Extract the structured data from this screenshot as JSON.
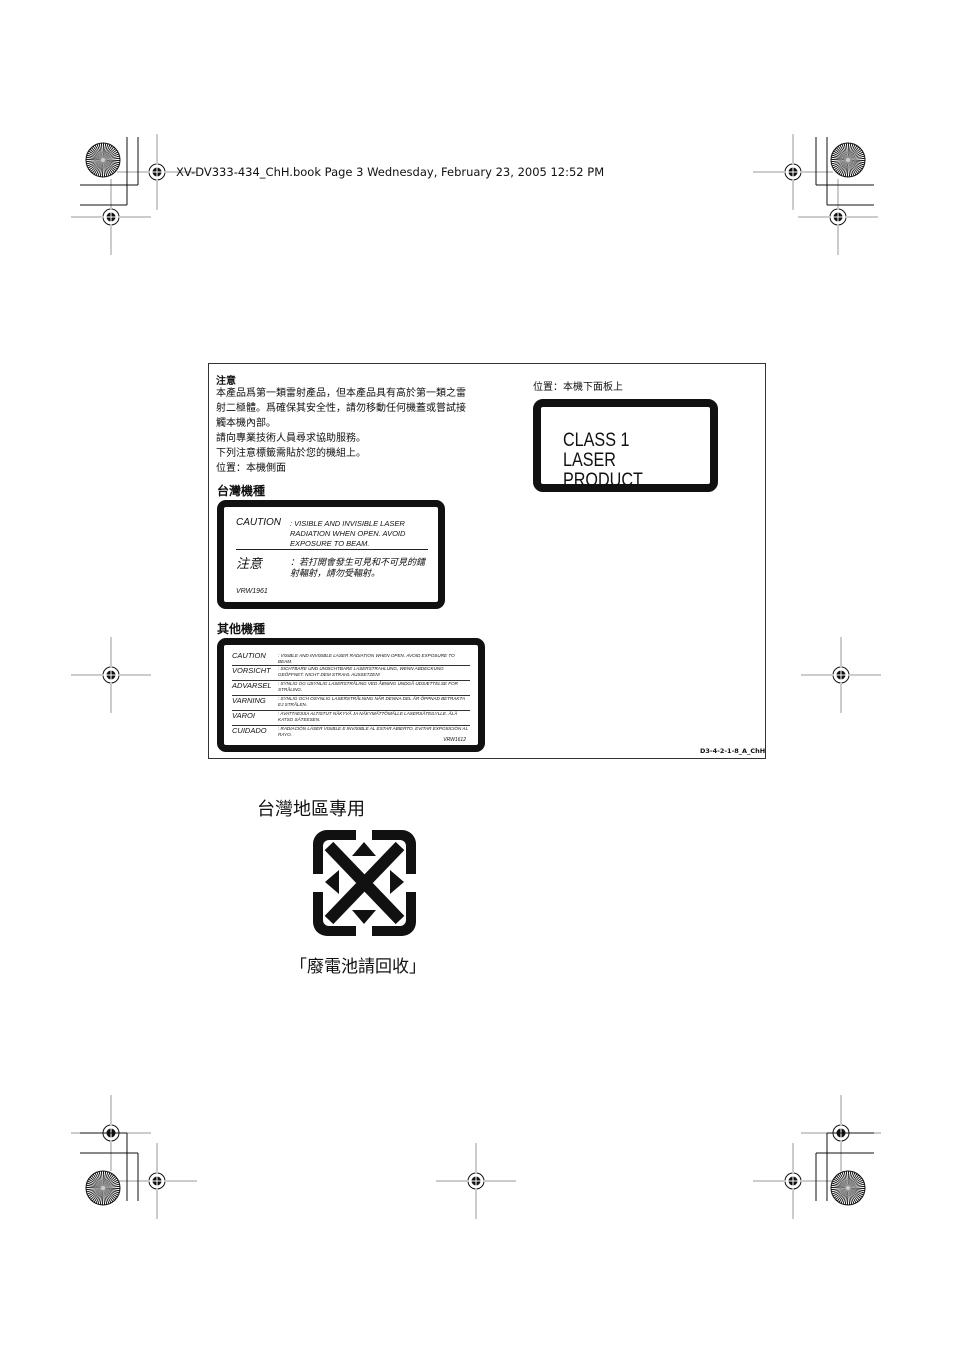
{
  "header": {
    "text": "XV-DV333-434_ChH.book  Page 3  Wednesday, February 23, 2005  12:52 PM"
  },
  "notice": {
    "title": "注意",
    "lines": [
      "本產品爲第一類雷射產品，但本產品具有高於第一類之雷",
      "射二極體。爲確保其安全性，請勿移動任何機蓋或嘗試接",
      "觸本機內部。",
      "請向專業技術人員尋求協助服務。",
      "下列注意標籤需貼於您的機組上。",
      "位置：本機側面"
    ]
  },
  "taiwan_model": {
    "heading": "台灣機種",
    "label": {
      "caution_key": "CAUTION",
      "caution_text": ": VISIBLE AND INVISIBLE LASER RADIATION WHEN OPEN. AVOID EXPOSURE TO BEAM.",
      "zh_key": "注意",
      "zh_text": "：若打開會發生可見和不可見的鐳射輻射，請勿受輻射。",
      "code": "VRW1961"
    }
  },
  "other_models": {
    "heading": "其他機種",
    "rows": [
      {
        "key": "CAUTION",
        "text": ": VISIBLE AND INVISIBLE LASER RADIATION WHEN OPEN. AVOID EXPOSURE TO BEAM."
      },
      {
        "key": "VORSICHT",
        "text": ": SICHTBARE UND UNSICHTBARE LASERSTRAHLUNG, WENN ABDECKUNG GEÖFFNET. NICHT DEM STRAHL AUSSETZEN!"
      },
      {
        "key": "ADVARSEL",
        "text": ": SYNLIG OG USYNLIG LASERSTRÅLING VED ÅBNING UNDGÅ UDSÆTTELSE FOR STRÅLING."
      },
      {
        "key": "VARNING",
        "text": ": SYNLIG OCH OSYNLIG LASERSTRÅLNING NÄR DENNA DEL ÄR ÖPPNAD BETRAKTA EJ STRÅLEN."
      },
      {
        "key": "VAROI",
        "text": ": AVATTAESSA ALTISTUT NÄKYVÄ JA NÄKYMÄTTÖMÄLLE LASERSÄTEILYLLE. ÄLÄ KATSO SÄTEESEN."
      },
      {
        "key": "CUIDADO",
        "text": ": RADIACIÓN LÁSER VISIBLE E INVISIBLE AL ESTAR ABIERTO. EVITAR EXPOSICIÓN AL RAYO."
      }
    ],
    "code": "VRW1612"
  },
  "class_label": {
    "position": "位置：本機下面板上",
    "line1": "CLASS 1",
    "line2": "LASER PRODUCT"
  },
  "doc_code": "D3-4-2-1-8_A_ChH",
  "battery": {
    "region": "台灣地區專用",
    "recycle_icon": "battery-recycle-icon",
    "caption": "「廢電池請回收」"
  }
}
